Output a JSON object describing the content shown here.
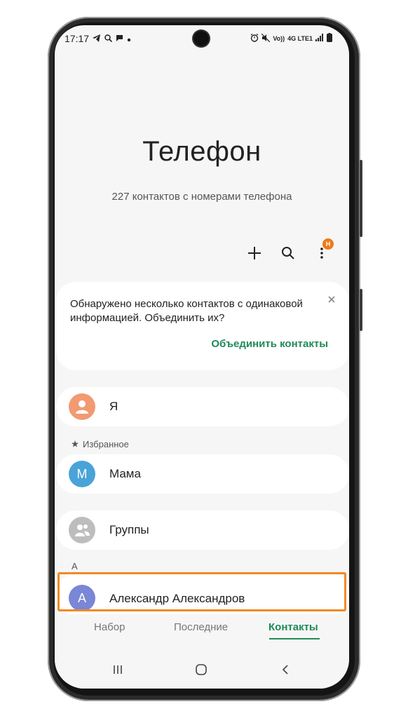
{
  "status_bar": {
    "time": "17:17",
    "lte_label": "4G LTE1",
    "vol_label": "Vo))"
  },
  "header": {
    "title": "Телефон",
    "subtitle": "227 контактов с номерами телефона"
  },
  "toolbar": {
    "add_icon": "plus-icon",
    "search_icon": "search-icon",
    "more_icon": "more-vertical-icon",
    "badge_text": "Н"
  },
  "notice": {
    "text": "Обнаружено несколько контактов с одинаковой информацией. Объединить их?",
    "action_label": "Объединить контакты"
  },
  "me": {
    "label": "Я"
  },
  "favorites": {
    "header": "Избранное",
    "items": [
      {
        "initial": "М",
        "name": "Мама"
      }
    ]
  },
  "groups": {
    "label": "Группы"
  },
  "contacts": {
    "section_letter": "А",
    "items": [
      {
        "initial": "А",
        "name": "Александр Александров"
      }
    ]
  },
  "tabs": [
    {
      "label": "Набор"
    },
    {
      "label": "Последние"
    },
    {
      "label": "Контакты"
    }
  ],
  "colors": {
    "accent": "#1f8a57",
    "badge": "#ef7a17",
    "highlight_border": "#f08a24",
    "avatar_me": "#f29a72",
    "avatar_mama": "#4aa3d8",
    "avatar_groups": "#bdbdbd",
    "avatar_contact": "#7a86d6"
  }
}
